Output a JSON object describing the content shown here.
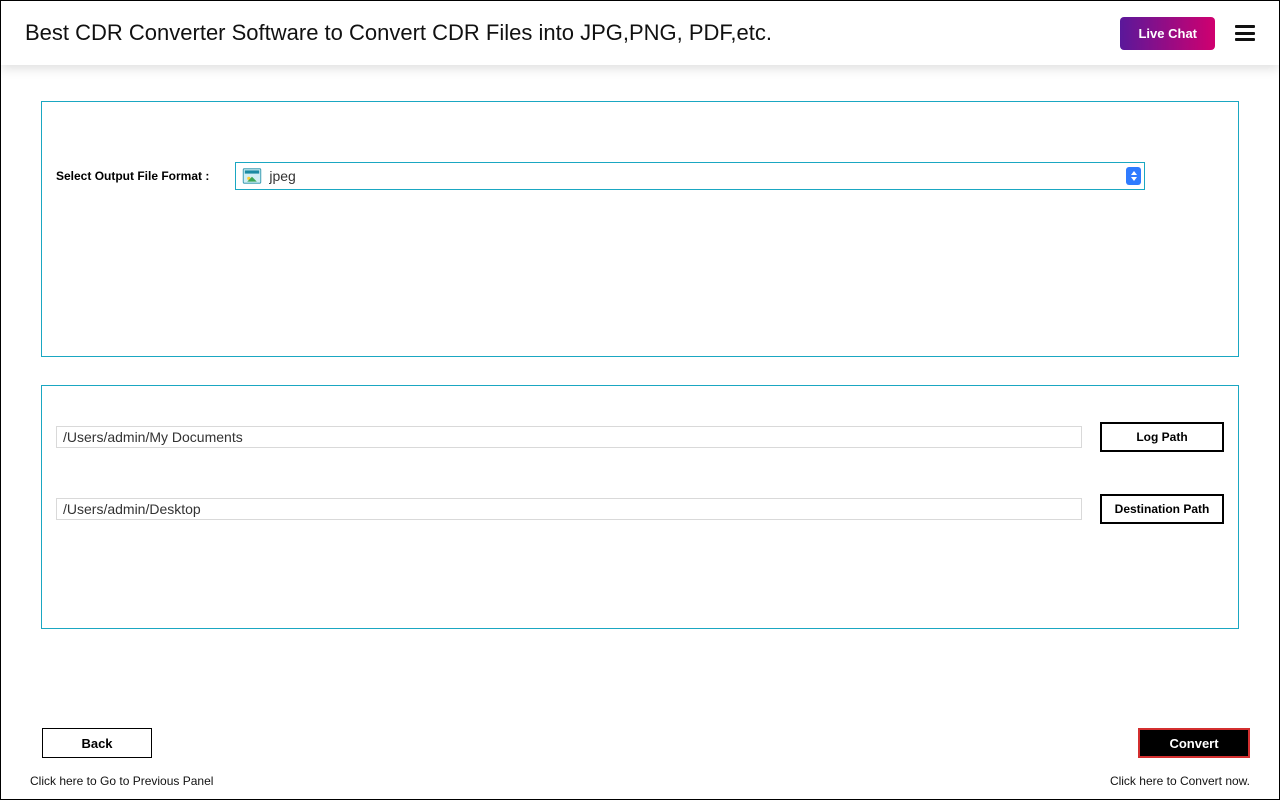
{
  "header": {
    "title": "Best CDR Converter Software to Convert CDR Files into JPG,PNG, PDF,etc.",
    "live_chat": "Live Chat"
  },
  "format": {
    "label": "Select Output File Format :",
    "value": "jpeg"
  },
  "paths": {
    "log_value": "/Users/admin/My Documents",
    "log_button": "Log Path",
    "dest_value": "/Users/admin/Desktop",
    "dest_button": "Destination Path"
  },
  "footer": {
    "back_label": "Back",
    "back_hint": "Click here to Go to Previous Panel",
    "convert_label": "Convert",
    "convert_hint": "Click here to Convert now."
  }
}
